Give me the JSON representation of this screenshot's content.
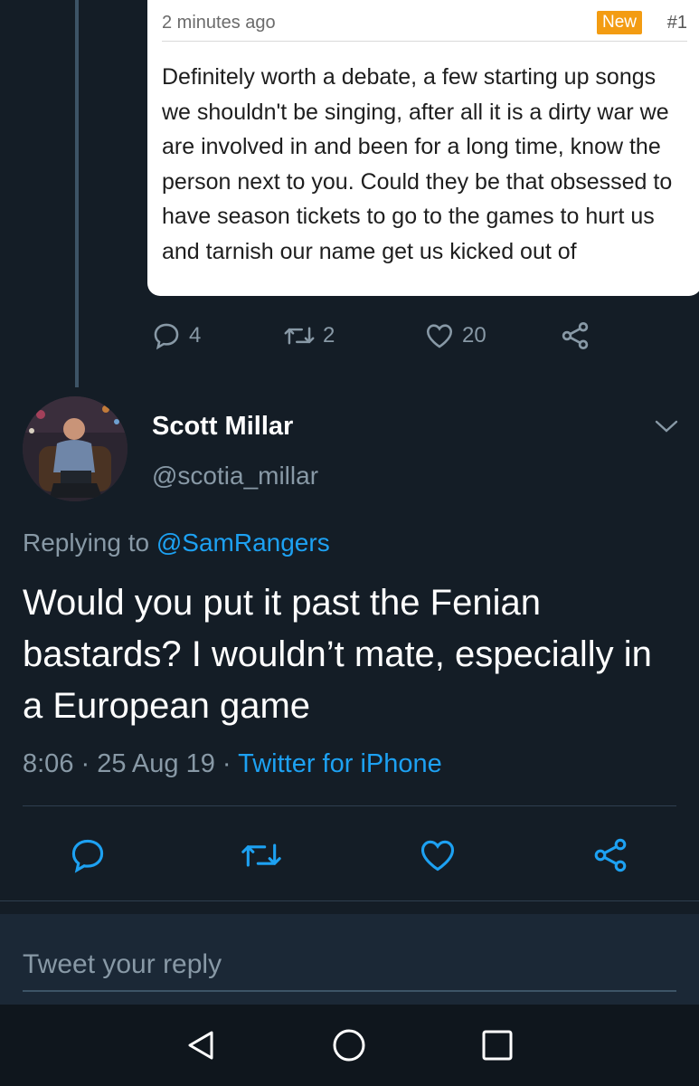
{
  "quoted_card": {
    "time": "2 minutes ago",
    "badge": "New",
    "number": "#1",
    "body": "Definitely worth a debate, a few starting up songs we shouldn't be singing, after all it is a dirty war we are involved in and been for a long time, know the person next to you. Could they be that obsessed to have season tickets to go to the games to hurt us and tarnish our name get us kicked out of"
  },
  "quoted_actions": {
    "replies": "4",
    "retweets": "2",
    "likes": "20"
  },
  "author": {
    "name": "Scott Millar",
    "handle": "@scotia_millar"
  },
  "replying": {
    "prefix": "Replying to ",
    "handle": "@SamRangers"
  },
  "tweet": {
    "text": "Would you put it past the Fenian bastards? I wouldn’t mate, especially in a European game",
    "time_date": "8:06 · 25 Aug 19 · ",
    "source": "Twitter for iPhone"
  },
  "reply_box": {
    "placeholder": "Tweet your reply"
  },
  "icons": {
    "reply": "reply-icon",
    "retweet": "retweet-icon",
    "like": "heart-icon",
    "share": "share-icon",
    "menu": "chevron-down-icon",
    "nav_back": "triangle-back-icon",
    "nav_home": "circle-home-icon",
    "nav_recents": "square-recents-icon"
  },
  "colors": {
    "background": "#141d26",
    "accent": "#1da1f2",
    "muted": "#8899a6",
    "badge": "#f39c12"
  }
}
